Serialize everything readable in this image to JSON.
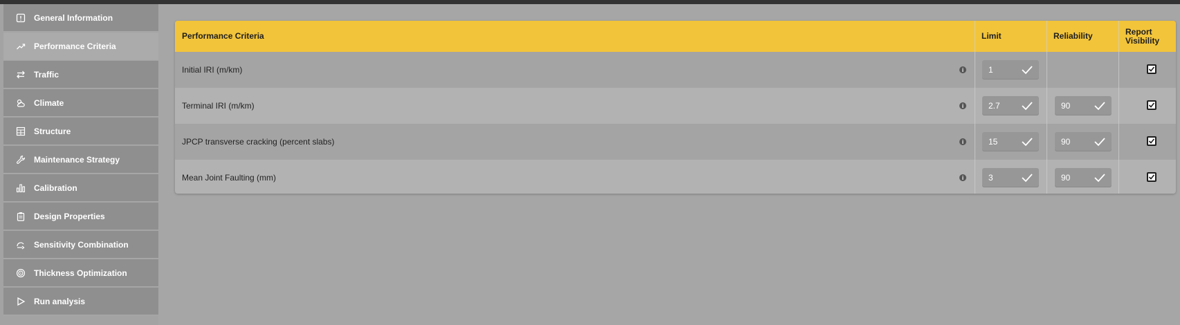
{
  "sidebar": {
    "items": [
      {
        "label": "General Information",
        "icon": "info-square-icon",
        "active": false
      },
      {
        "label": "Performance Criteria",
        "icon": "trend-up-icon",
        "active": true
      },
      {
        "label": "Traffic",
        "icon": "swap-arrows-icon",
        "active": false
      },
      {
        "label": "Climate",
        "icon": "weather-icon",
        "active": false
      },
      {
        "label": "Structure",
        "icon": "layers-grid-icon",
        "active": false
      },
      {
        "label": "Maintenance Strategy",
        "icon": "wrench-icon",
        "active": false
      },
      {
        "label": "Calibration",
        "icon": "bar-chart-icon",
        "active": false
      },
      {
        "label": "Design Properties",
        "icon": "clipboard-icon",
        "active": false
      },
      {
        "label": "Sensitivity Combination",
        "icon": "gauge-arrow-icon",
        "active": false
      },
      {
        "label": "Thickness Optimization",
        "icon": "target-icon",
        "active": false
      },
      {
        "label": "Run analysis",
        "icon": "play-icon",
        "active": false
      }
    ]
  },
  "table": {
    "headers": {
      "criteria": "Performance Criteria",
      "limit": "Limit",
      "reliability": "Reliability",
      "report_visibility_line1": "Report",
      "report_visibility_line2": "Visibility"
    },
    "rows": [
      {
        "label": "Initial IRI (m/km)",
        "limit": "1",
        "reliability": "",
        "visible": true
      },
      {
        "label": "Terminal IRI (m/km)",
        "limit": "2.7",
        "reliability": "90",
        "visible": true
      },
      {
        "label": "JPCP transverse cracking (percent slabs)",
        "limit": "15",
        "reliability": "90",
        "visible": true
      },
      {
        "label": "Mean Joint Faulting (mm)",
        "limit": "3",
        "reliability": "90",
        "visible": true
      }
    ]
  },
  "colors": {
    "header_accent": "#f2c43a",
    "sidebar_item": "#8f8f8f",
    "sidebar_active": "#ababab",
    "background": "#a6a6a6"
  }
}
